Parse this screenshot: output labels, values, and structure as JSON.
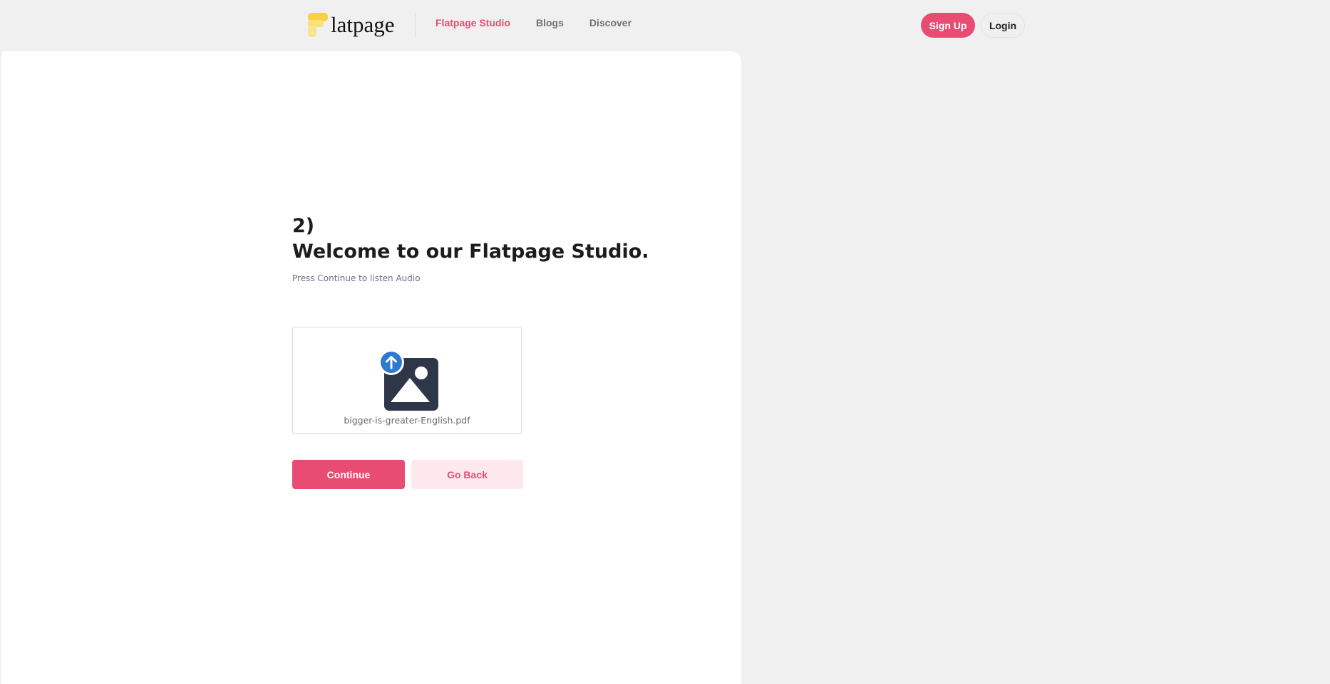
{
  "brand": {
    "logo_text": "latpage",
    "logo_letter": "F"
  },
  "nav": {
    "links": [
      {
        "label": "Flatpage Studio",
        "active": true
      },
      {
        "label": "Blogs",
        "active": false
      },
      {
        "label": "Discover",
        "active": false
      }
    ],
    "signup_label": "Sign Up",
    "login_label": "Login"
  },
  "main": {
    "step": "2)",
    "title": "Welcome to our Flatpage Studio.",
    "subtitle": "Press Continue to listen Audio",
    "upload": {
      "file_name": "bigger-is-greater-English.pdf",
      "icon": "image-upload-icon"
    },
    "continue_label": "Continue",
    "back_label": "Go Back"
  },
  "colors": {
    "accent": "#e84c72",
    "accent_light": "#fde8ee",
    "upload_badge": "#2f7ad1",
    "image_icon": "#2d3748",
    "logo_yellow": "#f5d33f"
  }
}
